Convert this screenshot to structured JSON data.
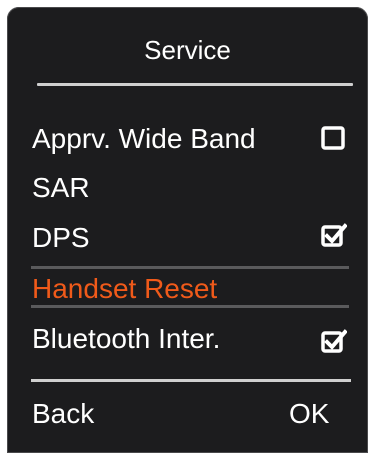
{
  "header": {
    "title": "Service"
  },
  "menu": {
    "items": [
      {
        "label": "Apprv. Wide Band",
        "checkbox": "unchecked",
        "selected": false
      },
      {
        "label": "SAR",
        "checkbox": "none",
        "selected": false
      },
      {
        "label": "DPS",
        "checkbox": "checked",
        "selected": false
      },
      {
        "label": "Handset Reset",
        "checkbox": "none",
        "selected": true
      },
      {
        "label": "Bluetooth Inter.",
        "checkbox": "checked",
        "selected": false
      }
    ]
  },
  "softkeys": {
    "left": "Back",
    "right": "OK"
  },
  "colors": {
    "background": "#1c1c1e",
    "text": "#ffffff",
    "highlight": "#f05a1a",
    "divider": "#cfcfcf"
  },
  "icons": {
    "unchecked": "checkbox-empty-icon",
    "checked": "checkbox-checked-icon"
  }
}
